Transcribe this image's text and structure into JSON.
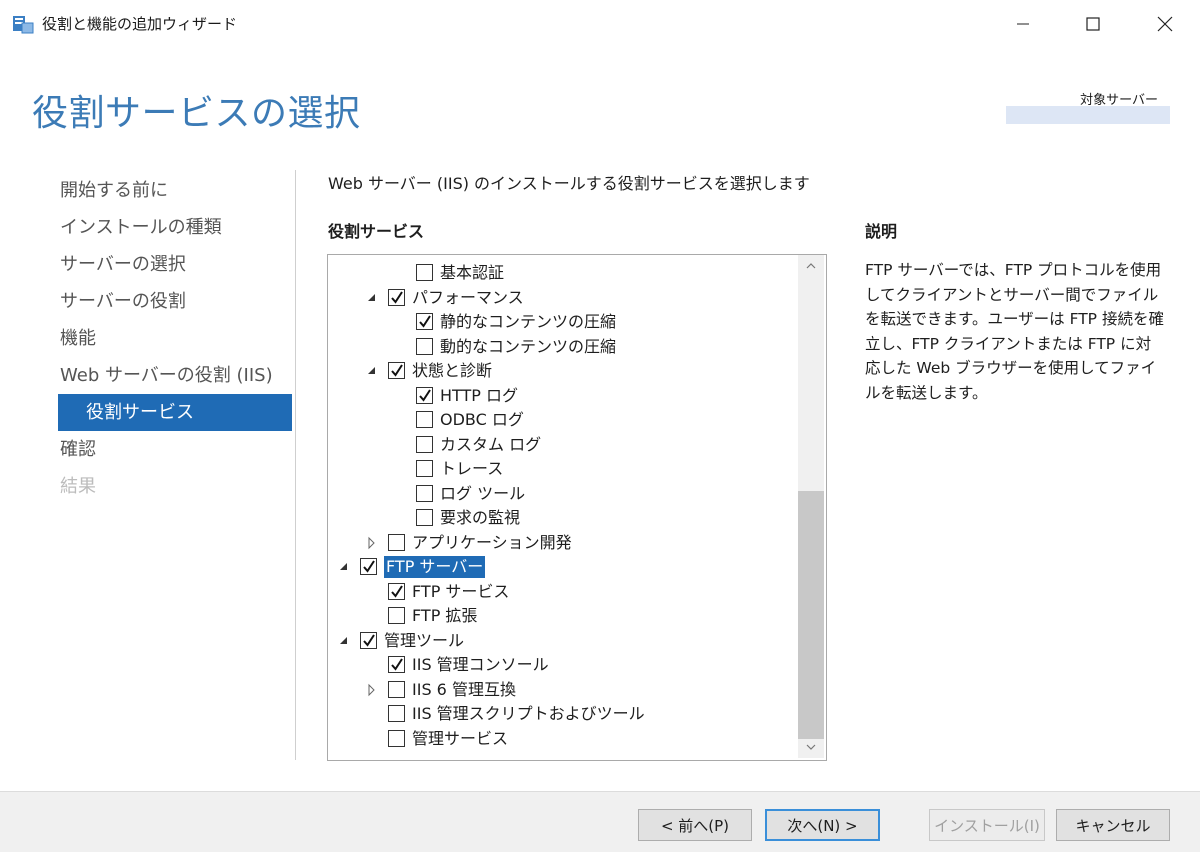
{
  "window": {
    "title": "役割と機能の追加ウィザード"
  },
  "header": {
    "title": "役割サービスの選択",
    "target_label": "対象サーバー",
    "target_value": ""
  },
  "nav": {
    "items": [
      {
        "label": "開始する前に",
        "state": "done"
      },
      {
        "label": "インストールの種類",
        "state": "done"
      },
      {
        "label": "サーバーの選択",
        "state": "done"
      },
      {
        "label": "サーバーの役割",
        "state": "done"
      },
      {
        "label": "機能",
        "state": "done"
      },
      {
        "label": "Web サーバーの役割 (IIS)",
        "state": "done"
      },
      {
        "label": "役割サービス",
        "state": "active"
      },
      {
        "label": "確認",
        "state": "done"
      },
      {
        "label": "結果",
        "state": "disabled"
      }
    ]
  },
  "main": {
    "instruction": "Web サーバー (IIS) のインストールする役割サービスを選択します",
    "section_label": "役割サービス",
    "tree": [
      {
        "label": "基本認証",
        "checked": false,
        "indent": 3,
        "expander": null
      },
      {
        "label": "パフォーマンス",
        "checked": true,
        "indent": 2,
        "expander": "expanded"
      },
      {
        "label": "静的なコンテンツの圧縮",
        "checked": true,
        "indent": 3,
        "expander": null
      },
      {
        "label": "動的なコンテンツの圧縮",
        "checked": false,
        "indent": 3,
        "expander": null
      },
      {
        "label": "状態と診断",
        "checked": true,
        "indent": 2,
        "expander": "expanded"
      },
      {
        "label": "HTTP ログ",
        "checked": true,
        "indent": 3,
        "expander": null
      },
      {
        "label": "ODBC ログ",
        "checked": false,
        "indent": 3,
        "expander": null
      },
      {
        "label": "カスタム ログ",
        "checked": false,
        "indent": 3,
        "expander": null
      },
      {
        "label": "トレース",
        "checked": false,
        "indent": 3,
        "expander": null
      },
      {
        "label": "ログ ツール",
        "checked": false,
        "indent": 3,
        "expander": null
      },
      {
        "label": "要求の監視",
        "checked": false,
        "indent": 3,
        "expander": null
      },
      {
        "label": "アプリケーション開発",
        "checked": false,
        "indent": 2,
        "expander": "collapsed"
      },
      {
        "label": "FTP サーバー",
        "checked": true,
        "indent": 1,
        "expander": "expanded",
        "selected": true
      },
      {
        "label": "FTP サービス",
        "checked": true,
        "indent": 2,
        "expander": null
      },
      {
        "label": "FTP 拡張",
        "checked": false,
        "indent": 2,
        "expander": null
      },
      {
        "label": "管理ツール",
        "checked": true,
        "indent": 1,
        "expander": "expanded"
      },
      {
        "label": "IIS 管理コンソール",
        "checked": true,
        "indent": 2,
        "expander": null
      },
      {
        "label": "IIS 6 管理互換",
        "checked": false,
        "indent": 2,
        "expander": "collapsed"
      },
      {
        "label": "IIS 管理スクリプトおよびツール",
        "checked": false,
        "indent": 2,
        "expander": null
      },
      {
        "label": "管理サービス",
        "checked": false,
        "indent": 2,
        "expander": null
      }
    ],
    "description_label": "説明",
    "description_text": "FTP サーバーでは、FTP プロトコルを使用してクライアントとサーバー間でファイルを転送できます。ユーザーは FTP 接続を確立し、FTP クライアントまたは FTP に対応した Web ブラウザーを使用してファイルを転送します。"
  },
  "footer": {
    "prev_label": "< 前へ(P)",
    "next_label": "次へ(N) >",
    "install_label": "インストール(I)",
    "cancel_label": "キャンセル"
  },
  "colors": {
    "accent": "#1f6bb5",
    "title": "#3c7bb6"
  }
}
